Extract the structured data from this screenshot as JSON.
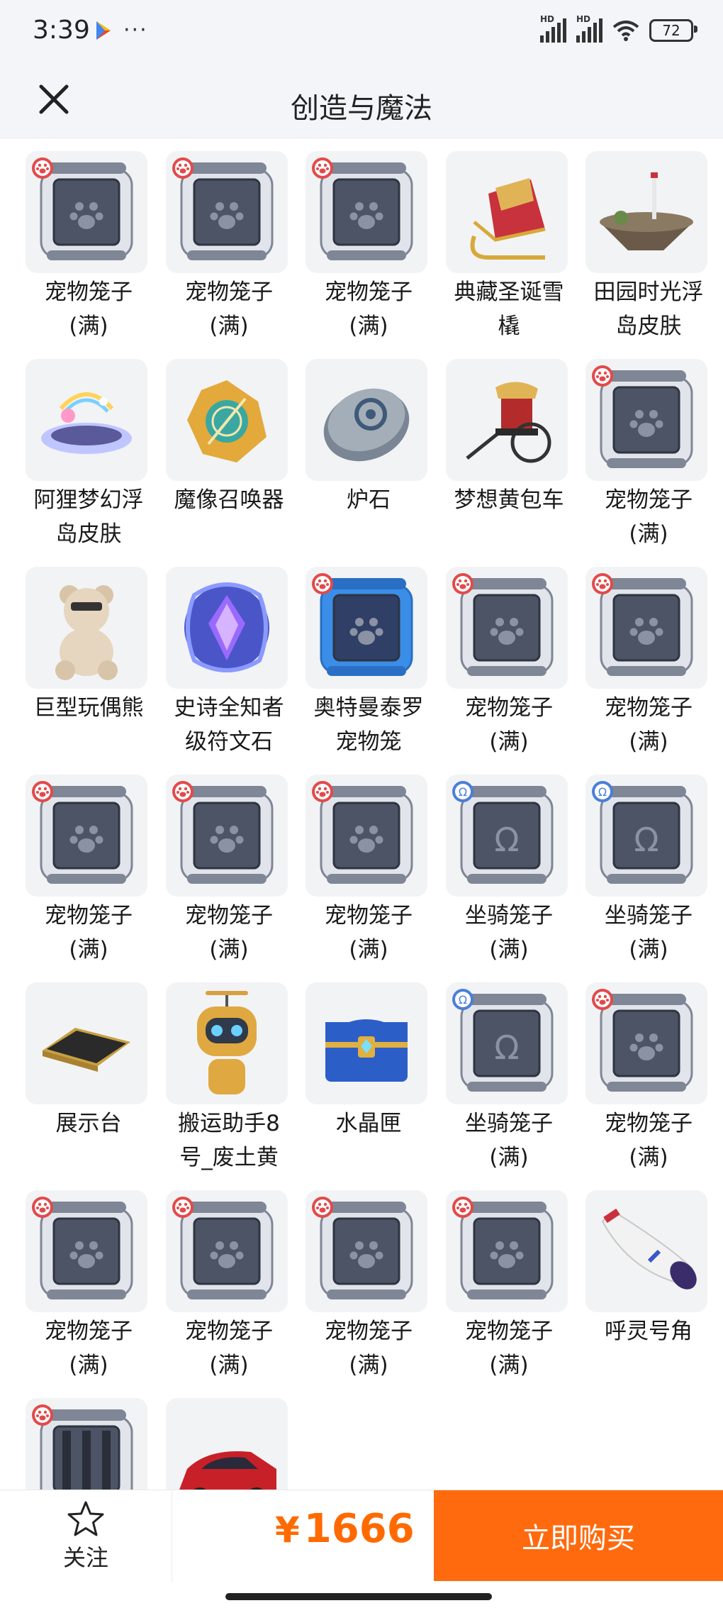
{
  "status": {
    "time": "3:39",
    "more": "···",
    "battery": "72",
    "hd1": "HD",
    "hd2": "HD"
  },
  "header": {
    "title": "创造与魔法"
  },
  "items": [
    {
      "label": "宠物笼子\n(满)",
      "icon": "pet-cage-icon"
    },
    {
      "label": "宠物笼子\n(满)",
      "icon": "pet-cage-icon"
    },
    {
      "label": "宠物笼子\n(满)",
      "icon": "pet-cage-icon"
    },
    {
      "label": "典藏圣诞雪\n橇",
      "icon": "sleigh-icon"
    },
    {
      "label": "田园时光浮\n岛皮肤",
      "icon": "floating-island-icon"
    },
    {
      "label": "阿狸梦幻浮\n岛皮肤",
      "icon": "dream-island-icon"
    },
    {
      "label": "魔像召唤器",
      "icon": "golem-summoner-icon"
    },
    {
      "label": "炉石",
      "icon": "hearthstone-icon"
    },
    {
      "label": "梦想黄包车",
      "icon": "rickshaw-icon"
    },
    {
      "label": "宠物笼子\n(满)",
      "icon": "pet-cage-icon"
    },
    {
      "label": "巨型玩偶熊",
      "icon": "teddy-bear-icon"
    },
    {
      "label": "史诗全知者\n级符文石",
      "icon": "rune-stone-icon"
    },
    {
      "label": "奥特曼泰罗\n宠物笼",
      "icon": "blue-pet-cage-icon"
    },
    {
      "label": "宠物笼子\n(满)",
      "icon": "pet-cage-icon"
    },
    {
      "label": "宠物笼子\n(满)",
      "icon": "pet-cage-icon"
    },
    {
      "label": "宠物笼子\n(满)",
      "icon": "pet-cage-icon"
    },
    {
      "label": "宠物笼子\n(满)",
      "icon": "pet-cage-icon"
    },
    {
      "label": "宠物笼子\n(满)",
      "icon": "pet-cage-icon"
    },
    {
      "label": "坐骑笼子\n(满)",
      "icon": "mount-cage-icon"
    },
    {
      "label": "坐骑笼子\n(满)",
      "icon": "mount-cage-icon"
    },
    {
      "label": "展示台",
      "icon": "display-stand-icon"
    },
    {
      "label": "搬运助手8\n号_废土黄",
      "icon": "robot-helper-icon"
    },
    {
      "label": "水晶匣",
      "icon": "crystal-chest-icon"
    },
    {
      "label": "坐骑笼子\n(满)",
      "icon": "mount-cage-icon"
    },
    {
      "label": "宠物笼子\n(满)",
      "icon": "pet-cage-icon"
    },
    {
      "label": "宠物笼子\n(满)",
      "icon": "pet-cage-icon"
    },
    {
      "label": "宠物笼子\n(满)",
      "icon": "pet-cage-icon"
    },
    {
      "label": "宠物笼子\n(满)",
      "icon": "pet-cage-icon"
    },
    {
      "label": "宠物笼子\n(满)",
      "icon": "pet-cage-icon"
    },
    {
      "label": "呼灵号角",
      "icon": "horn-icon"
    },
    {
      "label": "",
      "icon": "barred-cage-icon"
    },
    {
      "label": "",
      "icon": "red-car-icon"
    }
  ],
  "bottom": {
    "follow_label": "关注",
    "currency": "¥",
    "price": "1666",
    "buy_label": "立即购买"
  },
  "colors": {
    "accent": "#ff6a0e",
    "price": "#ff6a00",
    "header_bg": "#f3f5f8"
  }
}
